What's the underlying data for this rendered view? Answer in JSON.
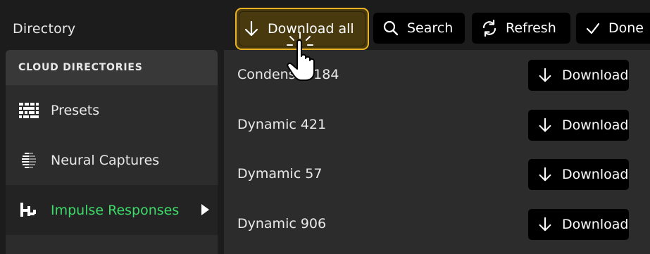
{
  "header": {
    "title": "Directory"
  },
  "toolbar": {
    "download_all_label": "Download all",
    "search_label": "Search",
    "refresh_label": "Refresh",
    "done_label": "Done"
  },
  "sidebar": {
    "heading": "CLOUD DIRECTORIES",
    "items": [
      {
        "label": "Presets",
        "icon": "presets-grid-icon",
        "active": false
      },
      {
        "label": "Neural Captures",
        "icon": "neural-capture-icon",
        "active": false
      },
      {
        "label": "Impulse Responses",
        "icon": "impulse-response-icon",
        "active": true
      }
    ]
  },
  "files": [
    {
      "name": "Condenser 184",
      "action": "Download"
    },
    {
      "name": "Dynamic 421",
      "action": "Download"
    },
    {
      "name": "Dymamic 57",
      "action": "Download"
    },
    {
      "name": "Dynamic 906",
      "action": "Download"
    }
  ],
  "colors": {
    "background": "#1c1c1c",
    "panel": "#2c2c2c",
    "highlight_border": "#e9b324",
    "highlight_fill": "#48390f",
    "active_text": "#3ddc6a"
  }
}
